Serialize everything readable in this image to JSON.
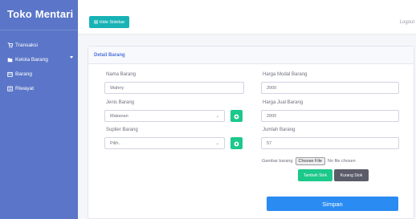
{
  "app": {
    "brand": "Toko Mentari"
  },
  "sidebar": {
    "items": [
      {
        "label": "Transaksi",
        "icon": "cart-icon"
      },
      {
        "label": "Kelola Barang",
        "icon": "folder-icon",
        "has_caret": true
      },
      {
        "label": "Barang",
        "icon": "box-icon"
      },
      {
        "label": "Riwayat",
        "icon": "history-icon"
      }
    ]
  },
  "topbar": {
    "hide_sidebar": "Hide Sidebar",
    "logout": "Logout"
  },
  "card": {
    "title": "Detail Barang"
  },
  "form": {
    "nama_label": "Nama Barang",
    "nama_value": "Wafery",
    "jenis_label": "Jenis Barang",
    "jenis_value": "Makanan",
    "suplier_label": "Suplier Barang",
    "suplier_value": "Pilih..",
    "harga_modal_label": "Harga Modal Barang",
    "harga_modal_value": "2000",
    "harga_jual_label": "Harga Jual Barang",
    "harga_jual_value": "2000",
    "jumlah_label": "Jumlah Barang",
    "jumlah_value": "57",
    "gambar_label": "Gambar barang",
    "choose_file": "Choose File",
    "no_file": "No file chosen",
    "tambah_stok": "Tambah Stok",
    "kurang_stok": "Kurang Stok",
    "simpan": "Simpan"
  },
  "colors": {
    "sidebar": "#5b76c8",
    "accent_teal": "#17b3b6",
    "success": "#1cc88a",
    "dark": "#5a5c69",
    "primary": "#2a8bf2"
  }
}
